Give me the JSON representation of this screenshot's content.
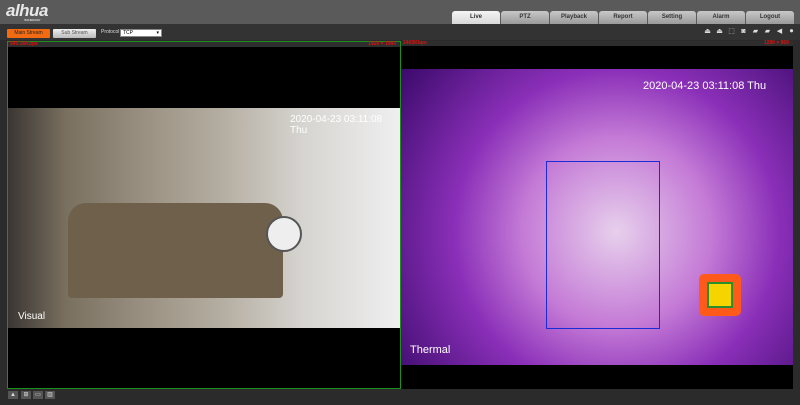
{
  "header": {
    "logo": "alhua",
    "logo_sub": "TECHNOLOGY",
    "tabs": [
      "Live",
      "PTZ",
      "Playback",
      "Report",
      "Setting",
      "Alarm",
      "Logout"
    ],
    "active_tab": "Live"
  },
  "toolbar": {
    "main_stream": "Main Stream",
    "sub_stream": "Sub Stream",
    "protocol_label": "Protocol",
    "protocol_value": "TCP",
    "icons": [
      "person-icon",
      "person-icon",
      "zoom-icon",
      "snapshot-icon",
      "record-icon",
      "record-settings-icon",
      "audio-icon",
      "microphone-icon"
    ]
  },
  "left_pane": {
    "bitrate": "545.36Kbps",
    "resolution": "1920 × 1080",
    "timestamp": "2020-04-23 03:11:08 Thu",
    "label": "Visual"
  },
  "right_pane": {
    "bitrate": "2405Kbps",
    "resolution": "1280 × 960",
    "timestamp": "2020-04-23 03:11:08 Thu",
    "label": "Thermal"
  },
  "footer": {
    "icons": [
      "window-single-icon",
      "window-split-icon",
      "fullscreen-icon",
      "stats-icon"
    ]
  }
}
